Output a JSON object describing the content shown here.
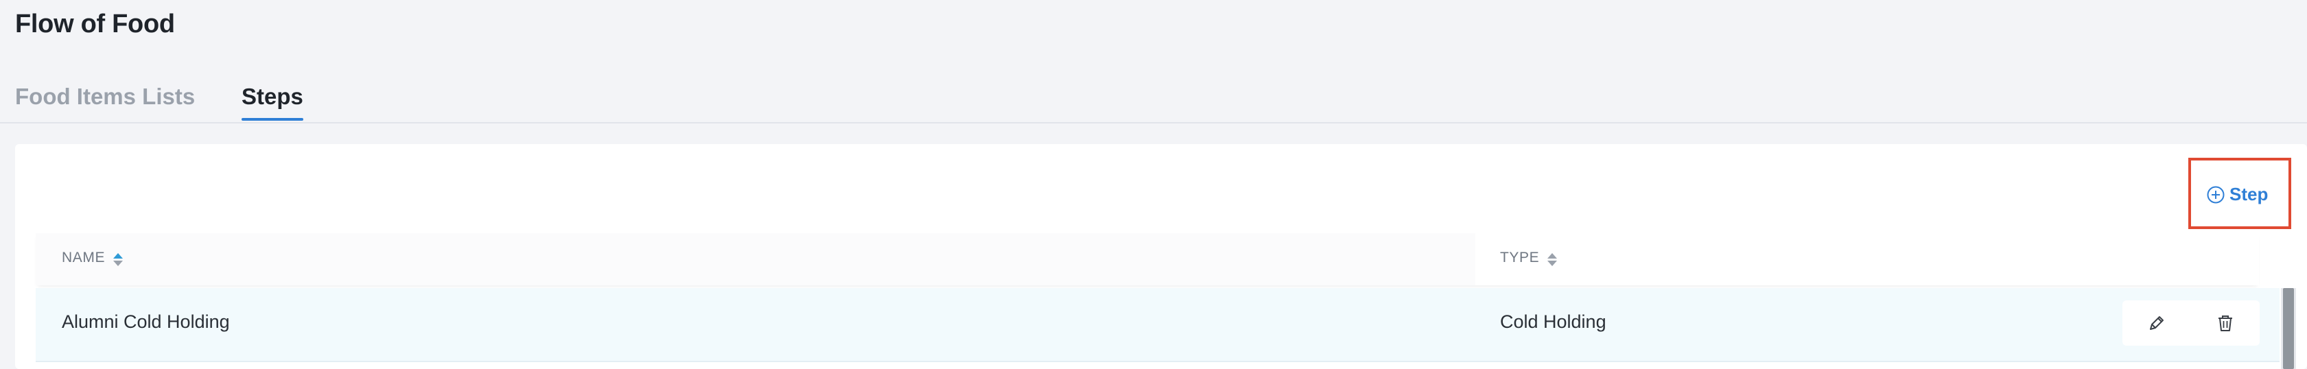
{
  "page": {
    "title": "Flow of Food"
  },
  "tabs": [
    {
      "label": "Food Items Lists",
      "active": false
    },
    {
      "label": "Steps",
      "active": true
    }
  ],
  "toolbar": {
    "add_step_label": "Step",
    "add_step_icon": "plus-circle-icon"
  },
  "table": {
    "columns": [
      {
        "label": "NAME",
        "sortable": true
      },
      {
        "label": "TYPE",
        "sortable": true
      }
    ],
    "rows": [
      {
        "name": "Alumni Cold Holding",
        "type": "Cold Holding",
        "actions": [
          "edit-icon",
          "trash-icon"
        ]
      }
    ]
  },
  "colors": {
    "accent": "#2f7fd6",
    "highlight": "#e04a32",
    "row_bg": "#f2fafd"
  }
}
